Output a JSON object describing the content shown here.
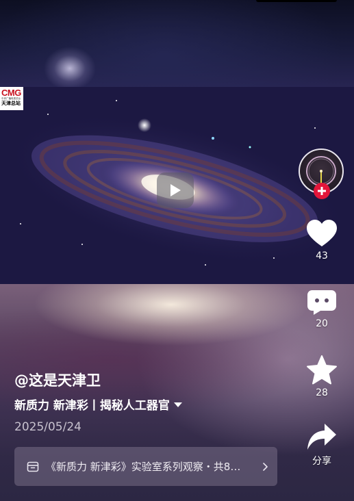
{
  "video": {
    "brand_logo": {
      "name": "CMG",
      "line1": "中央广播电视总台",
      "line2": "天津总站"
    },
    "play_icon": "play-icon"
  },
  "actions": {
    "follow_icon": "plus-icon",
    "like": {
      "icon": "heart-icon",
      "count": "43"
    },
    "comment": {
      "icon": "comment-icon",
      "count": "20"
    },
    "favorite": {
      "icon": "star-icon",
      "count": "28"
    },
    "share": {
      "icon": "share-arrow-icon",
      "label": "分享"
    }
  },
  "caption": {
    "author": "@这是天津卫",
    "title": "新质力 新津彩丨揭秘人工器官",
    "date": "2025/05/24"
  },
  "collection": {
    "icon": "collection-box-icon",
    "text": "《新质力 新津彩》实验室系列观察・共8…"
  },
  "colors": {
    "follow_red": "#e3163a",
    "cmg_red": "#c8101e"
  }
}
